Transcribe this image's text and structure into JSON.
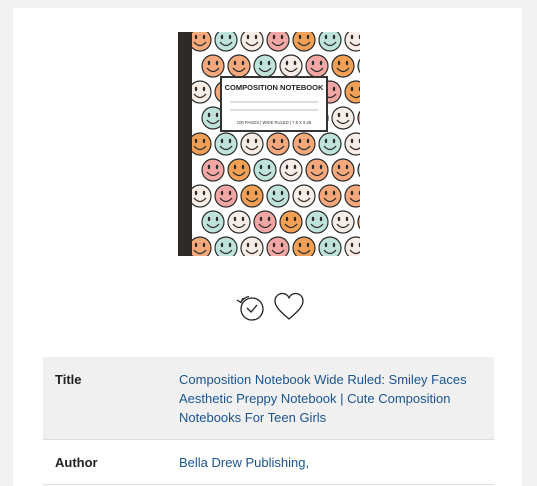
{
  "book": {
    "cover": {
      "label_title": "COMPOSITION NOTEBOOK",
      "label_subtitle": "100 PAGES | WIDE RULED | 7.5 X 9.25",
      "colors": {
        "spine": "#2d2a28",
        "peach": "#f4a87c",
        "pink": "#f3a7a4",
        "mint": "#bfe3da",
        "cream": "#f7ede6",
        "orange": "#f2a055"
      }
    },
    "actions": {
      "history_icon": "history-clock-icon",
      "favorite_icon": "heart-icon"
    },
    "details": {
      "title_label": "Title",
      "title_value": "Composition Notebook Wide Ruled: Smiley Faces Aesthetic Preppy Notebook | Cute Composition Notebooks For Teen Girls",
      "author_label": "Author",
      "author_value": "Bella Drew Publishing,"
    }
  }
}
